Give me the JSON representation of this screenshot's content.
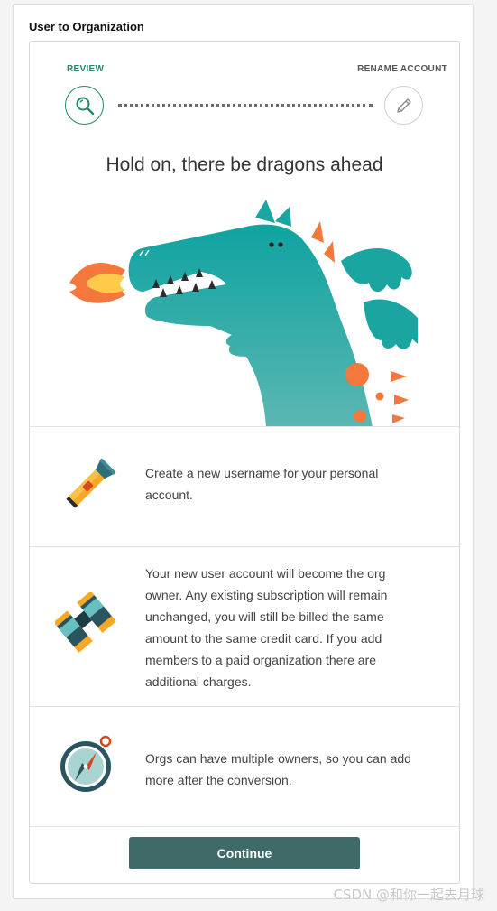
{
  "panel": {
    "title": "User to Organization"
  },
  "steps": {
    "review_label": "REVIEW",
    "rename_label": "RENAME ACCOUNT"
  },
  "headline": "Hold on, there be dragons ahead",
  "features": [
    {
      "icon": "flashlight-icon",
      "text": "Create a new username for your personal account."
    },
    {
      "icon": "binoculars-icon",
      "text": "Your new user account will become the org owner. Any existing subscription will remain unchanged, you will still be billed the same amount to the same credit card. If you add members to a paid organization there are additional charges."
    },
    {
      "icon": "compass-icon",
      "text": "Orgs can have multiple owners, so you can add more after the conversion."
    }
  ],
  "continue_label": "Continue",
  "watermark": "CSDN @和你一起去月球",
  "colors": {
    "accent_green": "#1f8a6c",
    "button": "#3f6a68",
    "dragon_teal": "#1aa5a0",
    "fire_orange": "#f4783b"
  }
}
